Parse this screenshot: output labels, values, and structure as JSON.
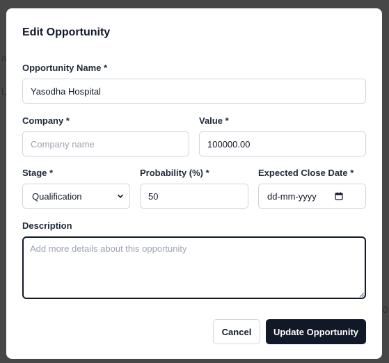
{
  "background": {
    "glyphs": [
      "a",
      "L",
      "0"
    ]
  },
  "modal": {
    "title": "Edit Opportunity",
    "fields": {
      "opportunity_name": {
        "label": "Opportunity Name *",
        "value": "Yasodha Hospital",
        "placeholder": ""
      },
      "company": {
        "label": "Company *",
        "value": "",
        "placeholder": "Company name"
      },
      "value": {
        "label": "Value *",
        "value": "100000.00",
        "placeholder": ""
      },
      "stage": {
        "label": "Stage *",
        "selected": "Qualification"
      },
      "probability": {
        "label": "Probability (%) *",
        "value": "50",
        "placeholder": ""
      },
      "expected_close_date": {
        "label": "Expected Close Date *",
        "value": "dd-mm-yyyy"
      },
      "description": {
        "label": "Description",
        "value": "",
        "placeholder": "Add more details about this opportunity"
      }
    },
    "buttons": {
      "cancel_label": "Cancel",
      "submit_label": "Update Opportunity"
    }
  },
  "colors": {
    "backdrop": "#474747",
    "modal_bg": "#ffffff",
    "primary": "#111827",
    "border": "#d1d5db",
    "placeholder": "#9ca3af"
  },
  "icons": {
    "stage_dropdown": "chevron-down-icon",
    "date_picker": "calendar-icon",
    "textarea_resize": "resize-grip-icon"
  }
}
